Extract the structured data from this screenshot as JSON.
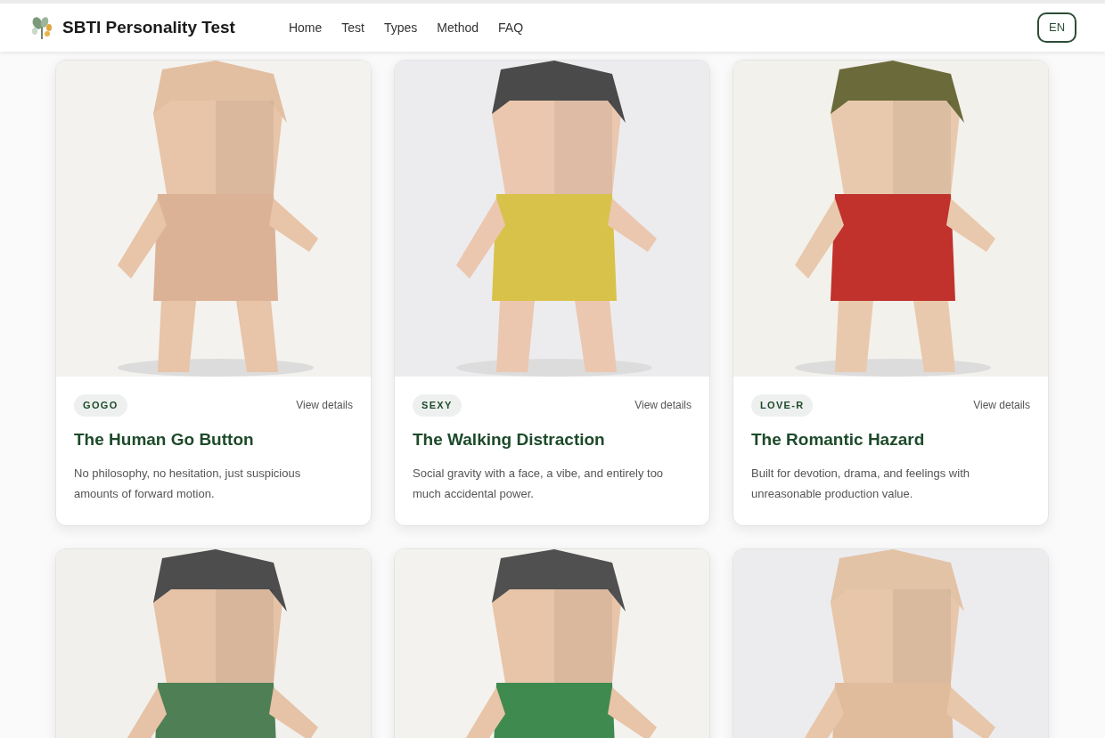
{
  "header": {
    "brand": "SBTI Personality Test",
    "nav": [
      {
        "label": "Home"
      },
      {
        "label": "Test"
      },
      {
        "label": "Types"
      },
      {
        "label": "Method"
      },
      {
        "label": "FAQ"
      }
    ],
    "language": "EN"
  },
  "cards": [
    {
      "kind": "type",
      "code": "GOGO",
      "link": "View details",
      "title": "The Human Go Button",
      "description": "No philosophy, no hesitation, just suspicious amounts of forward motion."
    },
    {
      "kind": "type",
      "code": "SEXY",
      "link": "View details",
      "title": "The Walking Distraction",
      "description": "Social gravity with a face, a vibe, and entirely too much accidental power."
    },
    {
      "kind": "type",
      "code": "LOVE-R",
      "link": "View details",
      "title": "The Romantic Hazard",
      "description": "Built for devotion, drama, and feelings with unreasonable production value."
    },
    {
      "kind": "picture"
    },
    {
      "kind": "picture"
    },
    {
      "kind": "picture"
    }
  ]
}
